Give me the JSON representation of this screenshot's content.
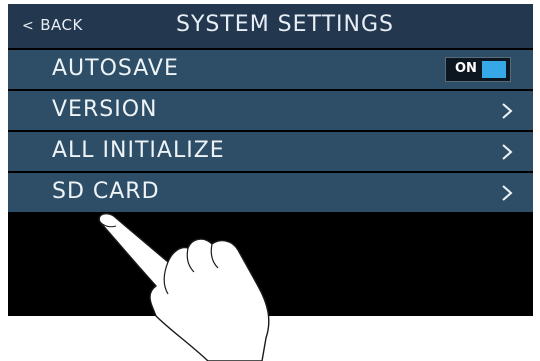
{
  "header": {
    "back_chevron": "<",
    "back_label": "BACK",
    "title": "SYSTEM SETTINGS"
  },
  "menu": {
    "items": [
      {
        "label": "AUTOSAVE",
        "control": "toggle",
        "toggle_state": "ON"
      },
      {
        "label": "VERSION",
        "control": "chevron"
      },
      {
        "label": "ALL INITIALIZE",
        "control": "chevron"
      },
      {
        "label": "SD CARD",
        "control": "chevron"
      }
    ]
  },
  "colors": {
    "header_bg": "#23384f",
    "row_bg": "#2d4e66",
    "toggle_accent": "#37a8e6"
  },
  "icons": {
    "chevron": "chevron-right-icon",
    "pointer": "hand-pointer-icon"
  }
}
